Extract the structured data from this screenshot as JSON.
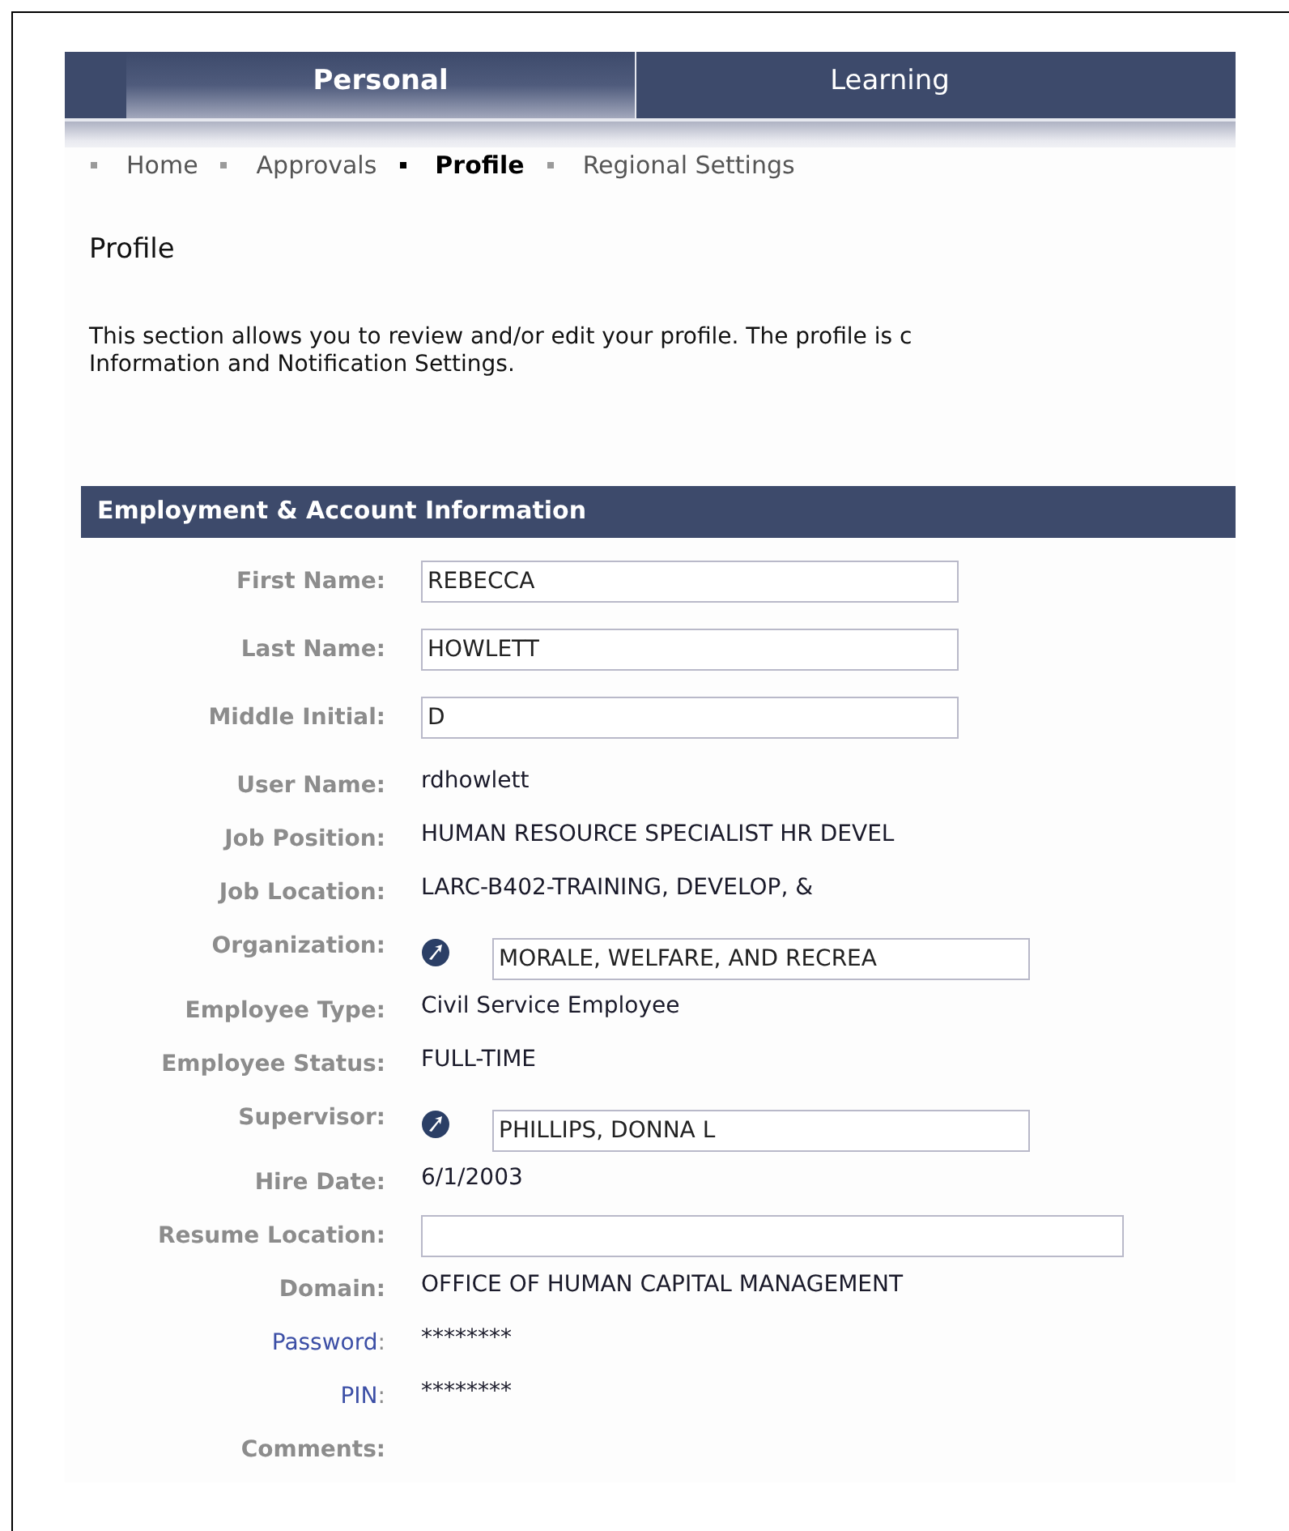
{
  "tabs": [
    {
      "label": "Personal",
      "selected": true
    },
    {
      "label": "Learning",
      "selected": false
    }
  ],
  "subnav": [
    {
      "label": "Home",
      "selected": false
    },
    {
      "label": "Approvals",
      "selected": false
    },
    {
      "label": "Profile",
      "selected": true
    },
    {
      "label": "Regional Settings",
      "selected": false
    }
  ],
  "page_title": "Profile",
  "description": [
    "This section allows you to review and/or edit your profile. The profile is c",
    "Information and Notification Settings."
  ],
  "section": {
    "title": "Employment & Account Information",
    "rows": [
      {
        "kind": "field",
        "label": "First Name:",
        "value": "REBECCA"
      },
      {
        "kind": "field",
        "label": "Last Name:",
        "value": "HOWLETT"
      },
      {
        "kind": "field",
        "label": "Middle Initial:",
        "value": "D"
      },
      {
        "kind": "text",
        "label": "User Name:",
        "value": "rdhowlett"
      },
      {
        "kind": "text",
        "label": "Job Position:",
        "value": "HUMAN RESOURCE SPECIALIST HR DEVEL"
      },
      {
        "kind": "text",
        "label": "Job Location:",
        "value": "LARC-B402-TRAINING, DEVELOP, &"
      },
      {
        "kind": "lookup",
        "label": "Organization:",
        "value": "MORALE, WELFARE, AND RECREA"
      },
      {
        "kind": "text",
        "label": "Employee Type:",
        "value": "Civil Service Employee"
      },
      {
        "kind": "text",
        "label": "Employee Status:",
        "value": "FULL-TIME"
      },
      {
        "kind": "lookup",
        "label": "Supervisor:",
        "value": "PHILLIPS, DONNA L"
      },
      {
        "kind": "text",
        "label": "Hire Date:",
        "value": "6/1/2003"
      },
      {
        "kind": "wide_field",
        "label": "Resume Location:"
      },
      {
        "kind": "text",
        "label": "Domain:",
        "value": "OFFICE OF HUMAN CAPITAL MANAGEMENT"
      },
      {
        "kind": "link",
        "label": "Password",
        "suffix": ":",
        "value": "********"
      },
      {
        "kind": "link",
        "label": "PIN",
        "suffix": ":",
        "value": "********"
      },
      {
        "kind": "empty",
        "label": "Comments:"
      }
    ]
  }
}
